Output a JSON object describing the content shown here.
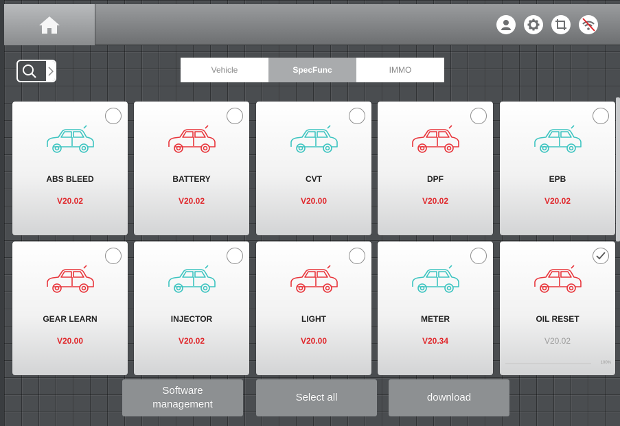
{
  "tabs": [
    {
      "label": "Vehicle",
      "active": false
    },
    {
      "label": "SpecFunc",
      "active": true
    },
    {
      "label": "IMMO",
      "active": false
    }
  ],
  "cards": [
    {
      "name": "ABS BLEED",
      "version": "V20.02",
      "car_color": "#3cc4c0",
      "selected": false
    },
    {
      "name": "BATTERY",
      "version": "V20.02",
      "car_color": "#e8343a",
      "selected": false
    },
    {
      "name": "CVT",
      "version": "V20.00",
      "car_color": "#3cc4c0",
      "selected": false
    },
    {
      "name": "DPF",
      "version": "V20.02",
      "car_color": "#e8343a",
      "selected": false
    },
    {
      "name": "EPB",
      "version": "V20.02",
      "car_color": "#3cc4c0",
      "selected": false
    },
    {
      "name": "GEAR LEARN",
      "version": "V20.00",
      "car_color": "#e8343a",
      "selected": false
    },
    {
      "name": "INJECTOR",
      "version": "V20.02",
      "car_color": "#3cc4c0",
      "selected": false
    },
    {
      "name": "LIGHT",
      "version": "V20.00",
      "car_color": "#e8343a",
      "selected": false
    },
    {
      "name": "METER",
      "version": "V20.34",
      "car_color": "#3cc4c0",
      "selected": false
    },
    {
      "name": "OIL RESET",
      "version": "V20.02",
      "car_color": "#e8343a",
      "selected": true,
      "downloaded": true,
      "progress": 1.0,
      "progress_text": "100%"
    }
  ],
  "buttons": {
    "software_management": "Software\nmanagement",
    "select_all": "Select all",
    "download": "download"
  },
  "colors": {
    "accent_red": "#e0262a",
    "car_teal": "#3cc4c0",
    "car_red": "#e8343a"
  },
  "icons": {
    "home": "home-icon",
    "user": "user-icon",
    "settings": "gear-icon",
    "screenshot": "crop-icon",
    "wifi": "wifi-off-icon",
    "search": "search-icon"
  }
}
